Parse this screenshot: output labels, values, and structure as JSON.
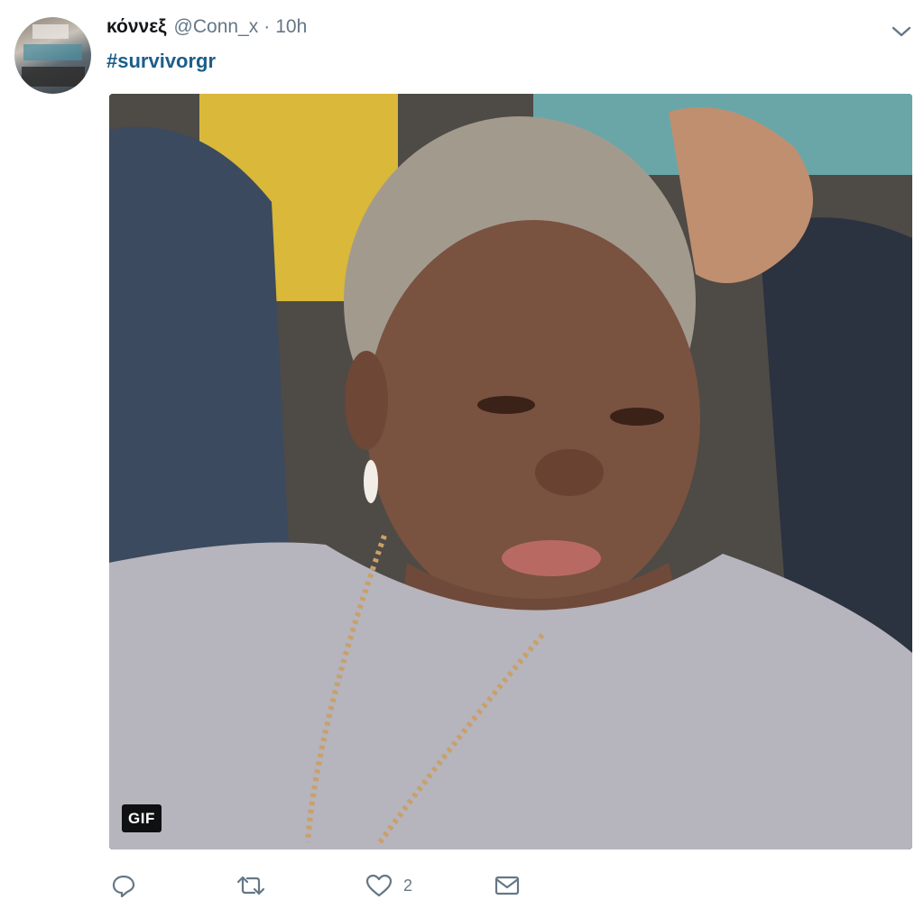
{
  "tweet": {
    "display_name": "κόννεξ",
    "handle": "@Conn_x",
    "separator": "·",
    "timestamp": "10h",
    "hashtag": "#survivorgr",
    "media": {
      "badge": "GIF",
      "icon": "gif-media"
    },
    "actions": {
      "reply_icon": "reply-icon",
      "retweet_icon": "retweet-icon",
      "like_icon": "heart-icon",
      "like_count": "2",
      "dm_icon": "envelope-icon"
    },
    "menu_icon": "chevron-down-icon"
  },
  "colors": {
    "name": "#14171a",
    "muted": "#657786",
    "hashtag": "#1b5e8a"
  }
}
